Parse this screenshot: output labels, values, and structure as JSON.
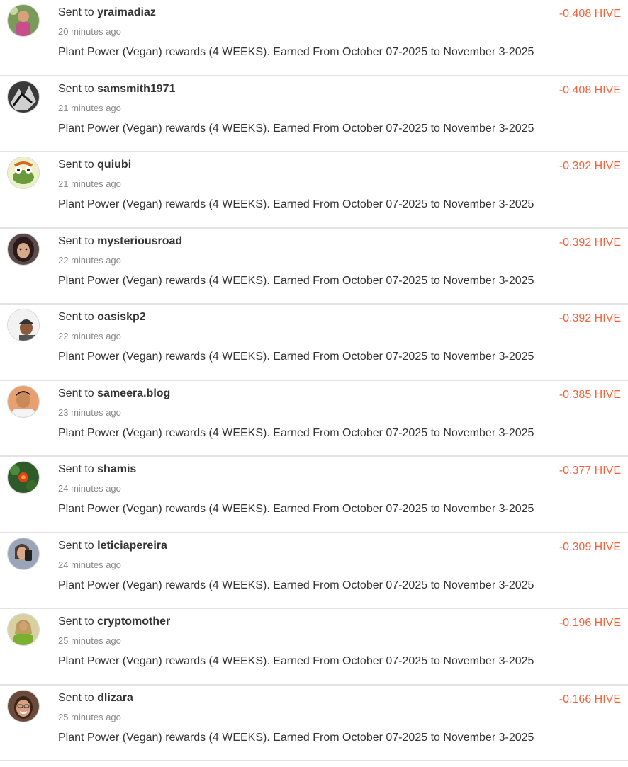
{
  "colors": {
    "amount": "#f4623a",
    "divider": "#e3e3e3",
    "text": "#333333",
    "muted": "#8a8a8a"
  },
  "transfers": [
    {
      "prefix": "Sent to",
      "user": "yraimadiaz",
      "time": "20 minutes ago",
      "memo": "Plant Power (Vegan) rewards (4 WEEKS). Earned From October 07-2025 to November 3-2025",
      "amount": "-0.408 HIVE",
      "avatar": "avatar-photo-child"
    },
    {
      "prefix": "Sent to",
      "user": "samsmith1971",
      "time": "21 minutes ago",
      "memo": "Plant Power (Vegan) rewards (4 WEEKS). Earned From October 07-2025 to November 3-2025",
      "amount": "-0.408 HIVE",
      "avatar": "avatar-bw-sketch"
    },
    {
      "prefix": "Sent to",
      "user": "quiubi",
      "time": "21 minutes ago",
      "memo": "Plant Power (Vegan) rewards (4 WEEKS). Earned From October 07-2025 to November 3-2025",
      "amount": "-0.392 HIVE",
      "avatar": "avatar-cartoon-face"
    },
    {
      "prefix": "Sent to",
      "user": "mysteriousroad",
      "time": "22 minutes ago",
      "memo": "Plant Power (Vegan) rewards (4 WEEKS). Earned From October 07-2025 to November 3-2025",
      "amount": "-0.392 HIVE",
      "avatar": "avatar-woman-portrait"
    },
    {
      "prefix": "Sent to",
      "user": "oasiskp2",
      "time": "22 minutes ago",
      "memo": "Plant Power (Vegan) rewards (4 WEEKS). Earned From October 07-2025 to November 3-2025",
      "amount": "-0.392 HIVE",
      "avatar": "avatar-man-cap"
    },
    {
      "prefix": "Sent to",
      "user": "sameera.blog",
      "time": "23 minutes ago",
      "memo": "Plant Power (Vegan) rewards (4 WEEKS). Earned From October 07-2025 to November 3-2025",
      "amount": "-0.385 HIVE",
      "avatar": "avatar-man-portrait"
    },
    {
      "prefix": "Sent to",
      "user": "shamis",
      "time": "24 minutes ago",
      "memo": "Plant Power (Vegan) rewards (4 WEEKS). Earned From October 07-2025 to November 3-2025",
      "amount": "-0.377 HIVE",
      "avatar": "avatar-flower"
    },
    {
      "prefix": "Sent to",
      "user": "leticiapereira",
      "time": "24 minutes ago",
      "memo": "Plant Power (Vegan) rewards (4 WEEKS). Earned From October 07-2025 to November 3-2025",
      "amount": "-0.309 HIVE",
      "avatar": "avatar-woman-phone"
    },
    {
      "prefix": "Sent to",
      "user": "cryptomother",
      "time": "25 minutes ago",
      "memo": "Plant Power (Vegan) rewards (4 WEEKS). Earned From October 07-2025 to November 3-2025",
      "amount": "-0.196 HIVE",
      "avatar": "avatar-woman-green"
    },
    {
      "prefix": "Sent to",
      "user": "dlizara",
      "time": "25 minutes ago",
      "memo": "Plant Power (Vegan) rewards (4 WEEKS). Earned From October 07-2025 to November 3-2025",
      "amount": "-0.166 HIVE",
      "avatar": "avatar-woman-smile"
    }
  ]
}
